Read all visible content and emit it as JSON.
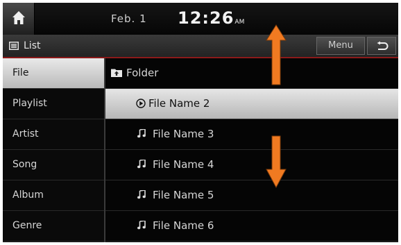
{
  "status_bar": {
    "date": "Feb.  1",
    "time": "12:26",
    "ampm": "AM"
  },
  "title_bar": {
    "title": "List",
    "menu_label": "Menu"
  },
  "left_menu": {
    "items": [
      {
        "label": "File",
        "active": true
      },
      {
        "label": "Playlist",
        "active": false
      },
      {
        "label": "Artist",
        "active": false
      },
      {
        "label": "Song",
        "active": false
      },
      {
        "label": "Album",
        "active": false
      },
      {
        "label": "Genre",
        "active": false
      }
    ]
  },
  "file_list": {
    "rows": [
      {
        "label": "Folder",
        "icon": "folder-up-icon"
      },
      {
        "label": "File Name 2",
        "icon": "play-circle-icon",
        "selected": true
      },
      {
        "label": "File Name 3",
        "icon": "music-note-icon"
      },
      {
        "label": "File Name 4",
        "icon": "music-note-icon"
      },
      {
        "label": "File Name 5",
        "icon": "music-note-icon"
      },
      {
        "label": "File Name 6",
        "icon": "music-note-icon"
      }
    ]
  },
  "colors": {
    "accent_red": "#8b1a1a",
    "arrow_orange": "#f07a21"
  },
  "icons": [
    "home-icon",
    "list-icon",
    "back-icon",
    "folder-up-icon",
    "play-circle-icon",
    "music-note-icon",
    "arrow-up-icon",
    "arrow-down-icon"
  ]
}
